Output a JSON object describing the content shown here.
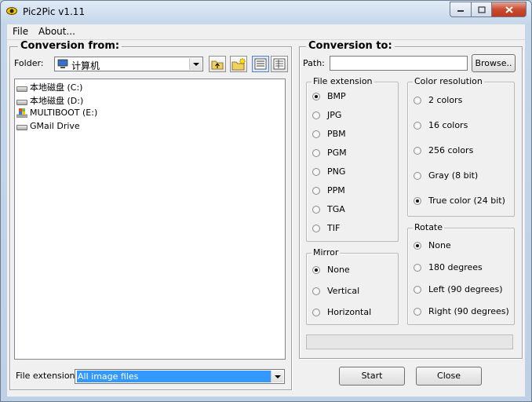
{
  "window": {
    "title": "Pic2Pic v1.11"
  },
  "menu": {
    "file": "File",
    "about": "About..."
  },
  "from": {
    "title": "Conversion from:",
    "folder_label": "Folder:",
    "folder_value": "计算机",
    "drives": [
      {
        "label": "本地磁盘 (C:)",
        "icon": "hard-drive-icon"
      },
      {
        "label": "本地磁盘 (D:)",
        "icon": "hard-drive-icon"
      },
      {
        "label": "MULTIBOOT (E:)",
        "icon": "windows-drive-icon"
      },
      {
        "label": "GMail Drive",
        "icon": "hard-drive-icon"
      }
    ],
    "file_ext_label": "File extension:",
    "file_ext_value": "All image files"
  },
  "to": {
    "title": "Conversion to:",
    "path_label": "Path:",
    "path_value": "",
    "browse": "Browse..",
    "file_extension": {
      "title": "File extension",
      "options": [
        "BMP",
        "JPG",
        "PBM",
        "PGM",
        "PNG",
        "PPM",
        "TGA",
        "TIF"
      ],
      "selected": "BMP"
    },
    "color_resolution": {
      "title": "Color resolution",
      "options": [
        "2 colors",
        "16 colors",
        "256 colors",
        "Gray (8 bit)",
        "True color (24 bit)"
      ],
      "selected": "True color (24 bit)"
    },
    "mirror": {
      "title": "Mirror",
      "options": [
        "None",
        "Vertical",
        "Horizontal"
      ],
      "selected": "None"
    },
    "rotate": {
      "title": "Rotate",
      "options": [
        "None",
        "180 degrees",
        "Left (90 degrees)",
        "Right (90 degrees)"
      ],
      "selected": "None"
    },
    "progress": 0
  },
  "buttons": {
    "start": "Start",
    "close": "Close"
  },
  "colors": {
    "selection": "#3399ff",
    "window_frame": "#bdd0e6",
    "face": "#f0f0f0"
  }
}
